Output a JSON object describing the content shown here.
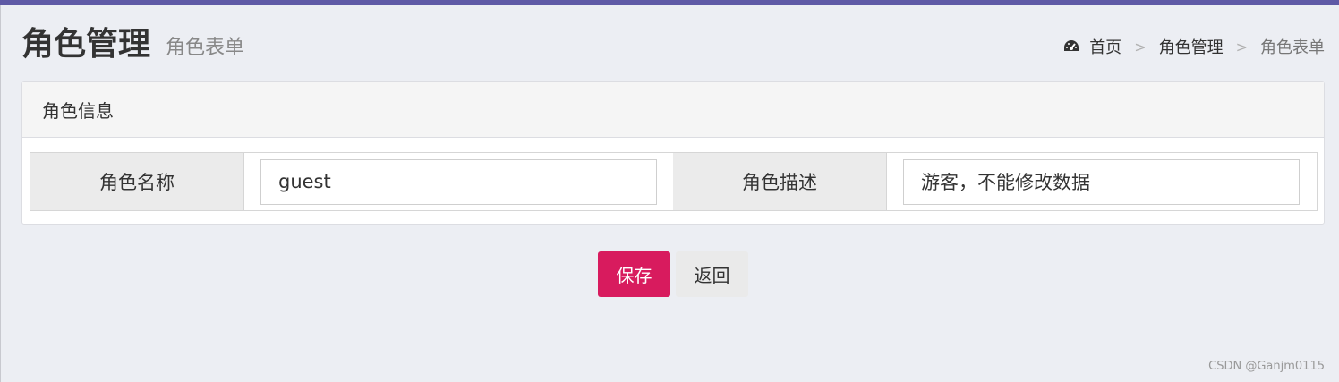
{
  "header": {
    "title": "角色管理",
    "subtitle": "角色表单"
  },
  "breadcrumb": {
    "icon": "dashboard-icon",
    "items": [
      "首页",
      "角色管理",
      "角色表单"
    ],
    "separator": ">"
  },
  "panel": {
    "title": "角色信息",
    "fields": {
      "name_label": "角色名称",
      "name_value": "guest",
      "desc_label": "角色描述",
      "desc_value": "游客，不能修改数据"
    }
  },
  "actions": {
    "save_label": "保存",
    "back_label": "返回"
  },
  "watermark": "CSDN @Ganjm0115",
  "colors": {
    "topbar": "#5f5aa6",
    "primary": "#d81b5e",
    "background": "#eceef3"
  }
}
